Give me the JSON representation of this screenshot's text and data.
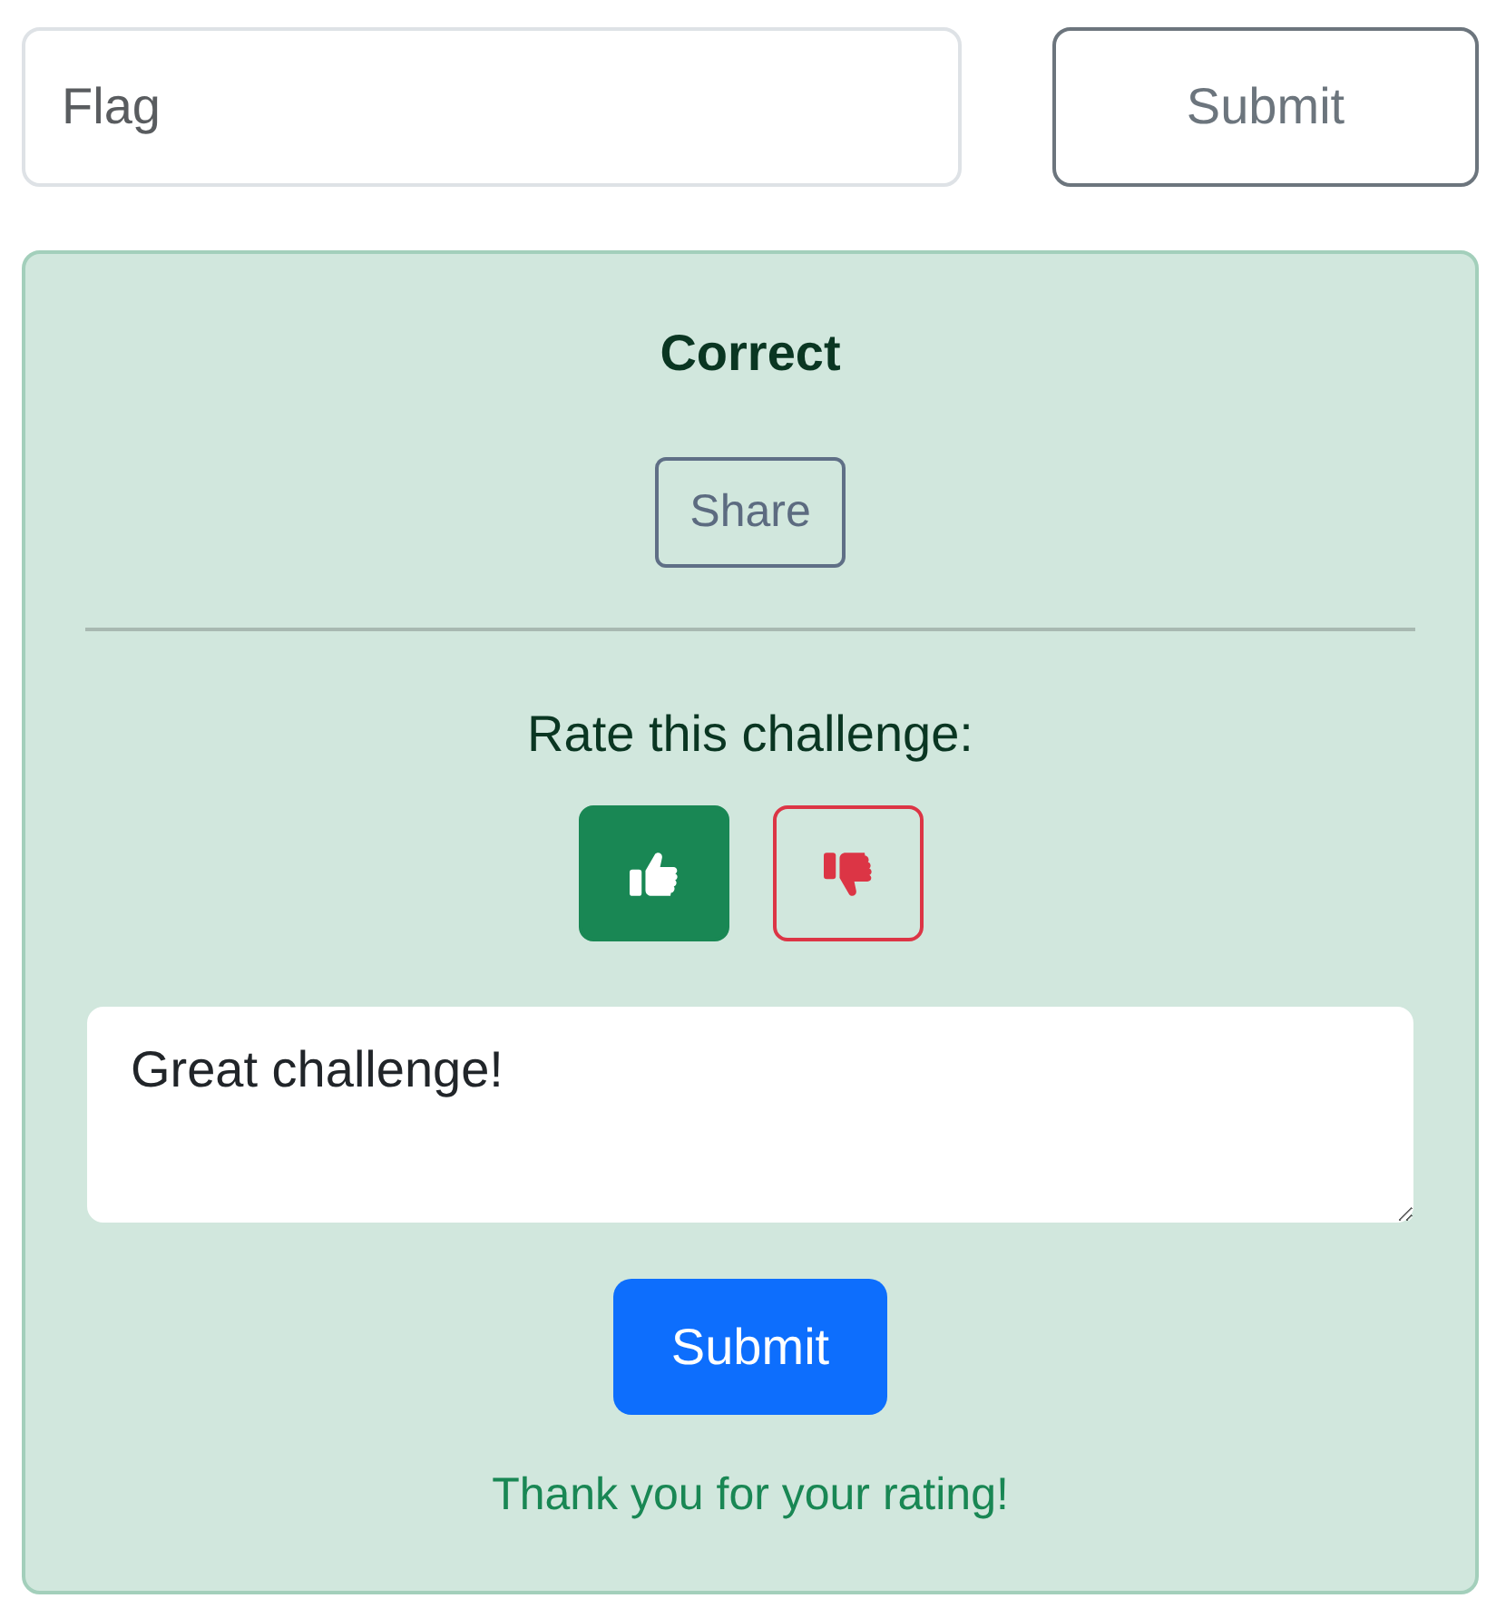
{
  "flag_form": {
    "flag_input": {
      "placeholder": "Flag"
    },
    "submit_button": "Submit"
  },
  "result": {
    "status": "Correct",
    "share_button": "Share",
    "rating": {
      "prompt": "Rate this challenge:",
      "votes": [
        {
          "kind": "up",
          "selected": true
        },
        {
          "kind": "down",
          "selected": false
        }
      ]
    },
    "comment": {
      "value": "Great challenge!"
    },
    "submit_button": "Submit",
    "message": "Thank you for your rating!"
  }
}
